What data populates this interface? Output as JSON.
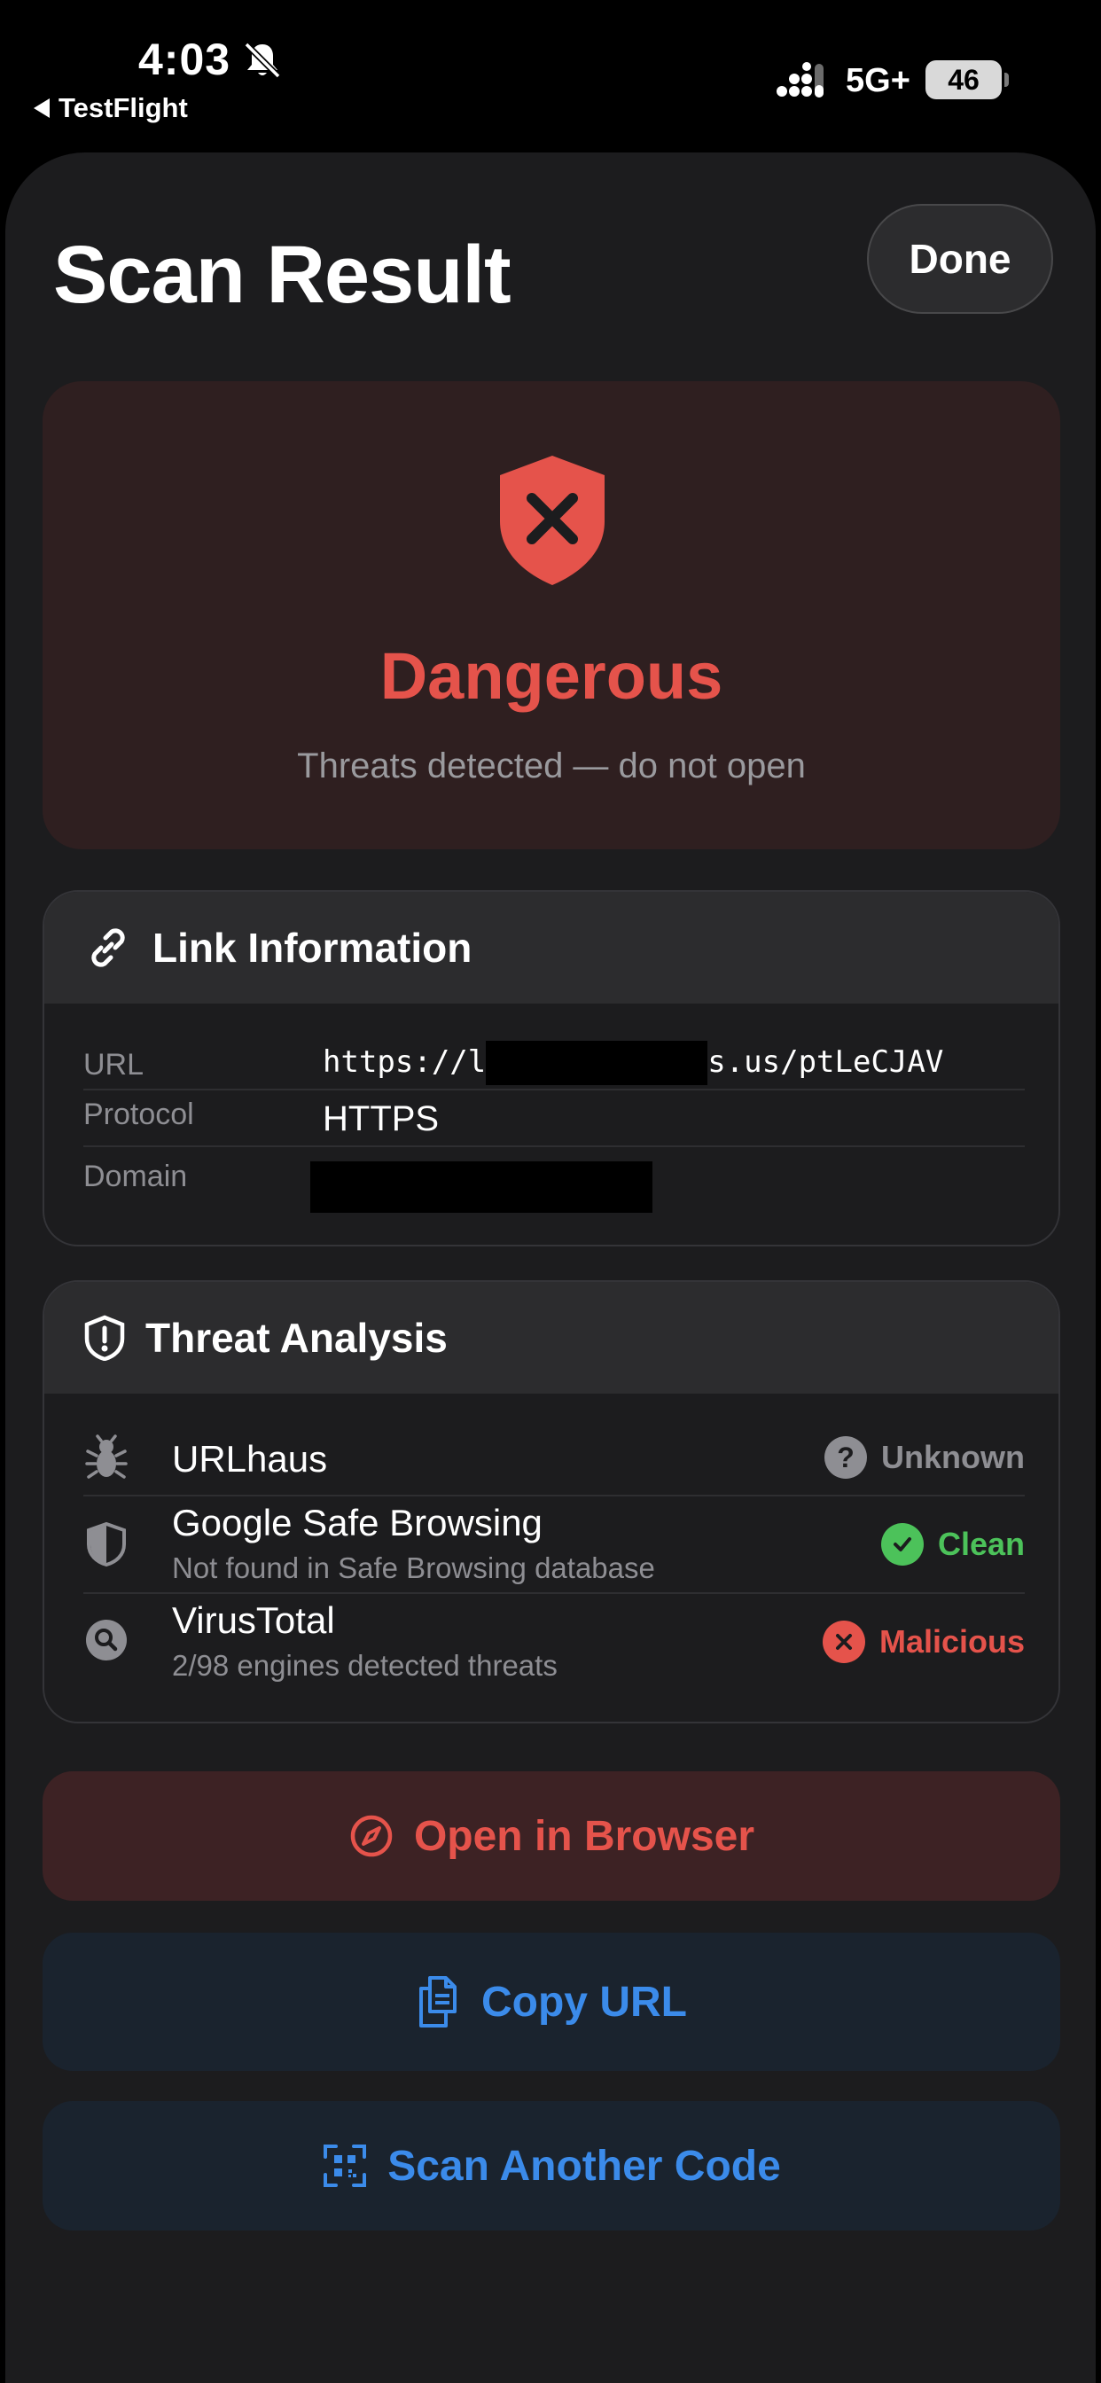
{
  "status_bar": {
    "time": "4:03",
    "back_app": "TestFlight",
    "network": "5G+",
    "battery": "46"
  },
  "header": {
    "title": "Scan Result",
    "done_label": "Done"
  },
  "verdict": {
    "title": "Dangerous",
    "subtitle": "Threats detected — do not open",
    "color": "#e5534b",
    "icon": "shield-x-icon"
  },
  "link_info": {
    "heading": "Link Information",
    "rows": [
      {
        "label": "URL",
        "value_prefix": "https://l",
        "value_suffix": "s.us/ptLeCJAV"
      },
      {
        "label": "Protocol",
        "value": "HTTPS"
      },
      {
        "label": "Domain",
        "value": ""
      }
    ]
  },
  "threat_analysis": {
    "heading": "Threat Analysis",
    "sources": [
      {
        "name": "URLhaus",
        "description": "",
        "status": "Unknown",
        "status_color": "#8e8e93",
        "icon": "bug-icon"
      },
      {
        "name": "Google Safe Browsing",
        "description": "Not found in Safe Browsing database",
        "status": "Clean",
        "status_color": "#4cc25a",
        "icon": "shield-half-icon"
      },
      {
        "name": "VirusTotal",
        "description": "2/98 engines detected threats",
        "status": "Malicious",
        "status_color": "#e5534b",
        "icon": "magnifier-icon"
      }
    ]
  },
  "actions": {
    "open_browser": "Open in Browser",
    "copy_url": "Copy URL",
    "scan_another": "Scan Another Code"
  }
}
